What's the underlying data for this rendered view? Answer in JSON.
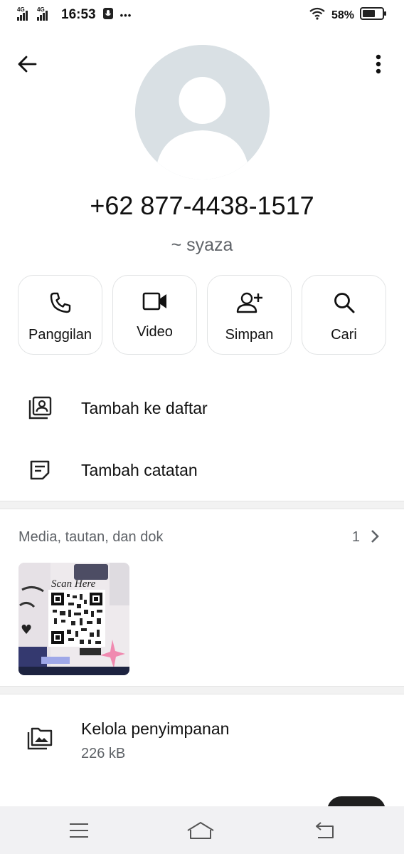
{
  "status_bar": {
    "network_1": "4G",
    "network_2": "4G",
    "time": "16:53",
    "more_indicator": "•••",
    "battery_percent": "58%"
  },
  "contact": {
    "phone_number": "+62 877-4438-1517",
    "name": "~ syaza"
  },
  "actions": [
    {
      "label": "Panggilan",
      "icon": "phone-icon"
    },
    {
      "label": "Video",
      "icon": "video-icon"
    },
    {
      "label": "Simpan",
      "icon": "add-person-icon"
    },
    {
      "label": "Cari",
      "icon": "search-icon"
    }
  ],
  "options": {
    "add_to_list": "Tambah ke daftar",
    "add_note": "Tambah catatan"
  },
  "media": {
    "title": "Media, tautan, dan dok",
    "count": "1",
    "thumbnail_text": "Scan Here"
  },
  "storage": {
    "title": "Kelola penyimpanan",
    "size": "226 kB"
  },
  "colors": {
    "avatar_bg": "#d9e0e4",
    "secondary_text": "#5f6368",
    "nav_bar_bg": "#f1f1f3"
  }
}
